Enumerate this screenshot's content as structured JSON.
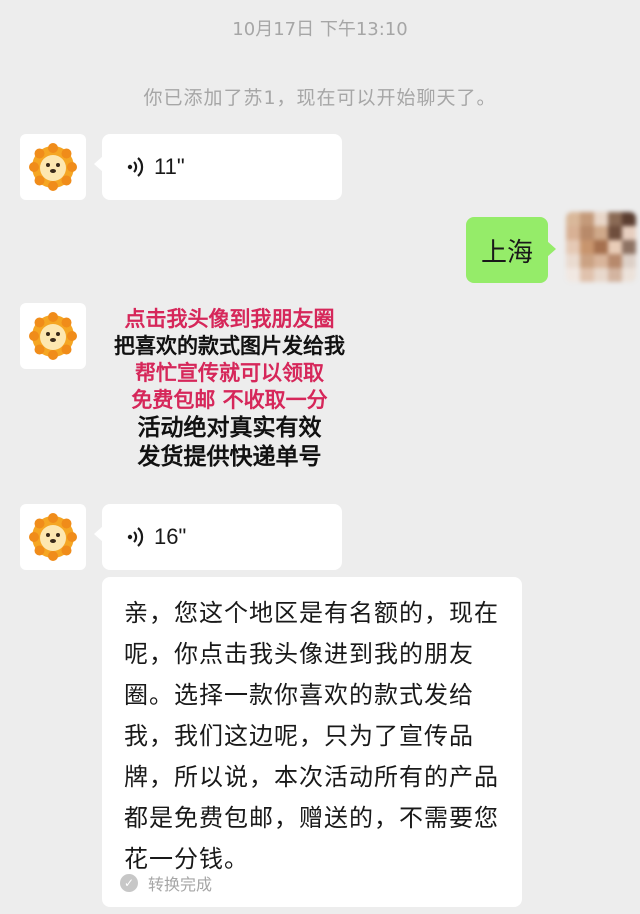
{
  "header": {
    "timestamp": "10月17日 下午13:10"
  },
  "system": {
    "added_notice": "你已添加了苏1，现在可以开始聊天了。"
  },
  "messages": {
    "voice_1": {
      "duration": "11\""
    },
    "user_reply": {
      "text": "上海"
    },
    "promo_lines": [
      "点击我头像到我朋友圈",
      "把喜欢的款式图片发给我",
      "帮忙宣传就可以领取",
      "免费包邮 不收取一分",
      "活动绝对真实有效",
      "发货提供快递单号"
    ],
    "voice_2": {
      "duration": "16\""
    },
    "transcript": {
      "text": "亲，您这个地区是有名额的，现在呢，你点击我头像进到我的朋友圈。选择一款你喜欢的款式发给我，我们这边呢，只为了宣传品牌，所以说，本次活动所有的产品都是免费包邮，赠送的，不需要您花一分钱。",
      "status": "转换完成"
    }
  },
  "icons": {
    "contact_avatar": "lion-mascot-icon",
    "voice": "voice-wave-icon",
    "convert_status": "check-circle-icon"
  },
  "colors": {
    "background": "#ededed",
    "my_bubble": "#95ec69",
    "their_bubble": "#ffffff",
    "promo_red": "#d6275a",
    "system_text": "#a6a6a6"
  }
}
